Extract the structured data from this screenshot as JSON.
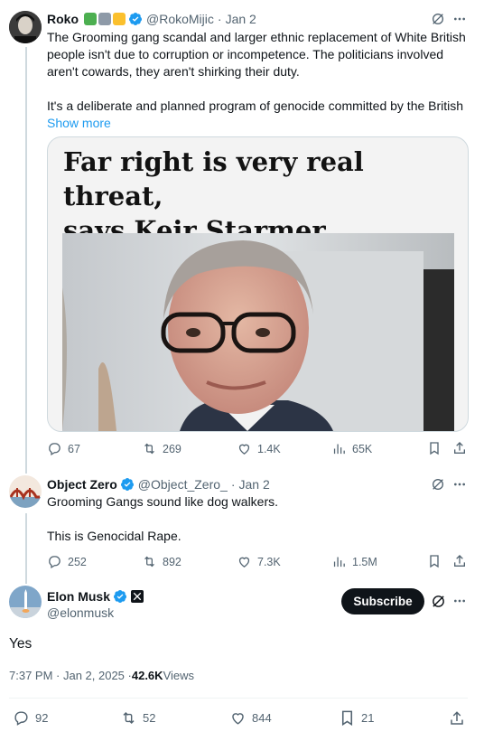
{
  "tweets": [
    {
      "name": "Roko",
      "handle": "@RokoMijic",
      "date": "Jan 2",
      "text_lines": [
        "The Grooming gang scandal and larger ethnic replacement of White British",
        "people isn't due to corruption or incompetence. The politicians involved",
        "aren't cowards, they aren't shirking their duty."
      ],
      "text2": "It's a deliberate and planned program of genocide committed by the British",
      "show_more": "Show more",
      "card_headline_1": "Far right is very real threat,",
      "card_headline_2": "says Keir Starmer",
      "replies": "67",
      "reposts": "269",
      "likes": "1.4K",
      "views": "65K"
    },
    {
      "name": "Object Zero",
      "handle": "@Object_Zero_",
      "date": "Jan 2",
      "text1": "Grooming Gangs sound like dog walkers.",
      "text2": "This is Genocidal Rape.",
      "replies": "252",
      "reposts": "892",
      "likes": "7.3K",
      "views": "1.5M"
    }
  ],
  "main_tweet": {
    "name": "Elon Musk",
    "handle": "@elonmusk",
    "subscribe_label": "Subscribe",
    "text": "Yes",
    "timestamp": "7:37 PM · Jan 2, 2025 · ",
    "views_count": "42.6K",
    "views_label": " Views",
    "replies": "92",
    "reposts": "52",
    "likes": "844",
    "bookmarks": "21"
  },
  "colors": {
    "verified": "#1d9bf0",
    "link": "#1d9bf0",
    "muted": "#536471",
    "text": "#0f1419"
  }
}
